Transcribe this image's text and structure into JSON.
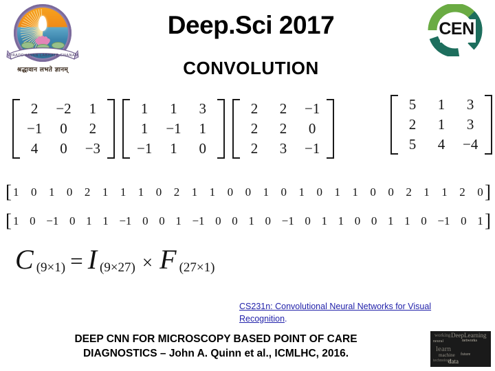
{
  "header": {
    "title": "Deep.Sci 2017",
    "subtitle": "CONVOLUTION",
    "university_logo": {
      "name": "university-emblem",
      "motto": "श्रद्धावान लभते ज्ञानम्",
      "banner_text": "SHRADDHAVAN LABHATE GNANAM",
      "colors": {
        "ring": "#8f7fae",
        "sky": "#f08a18",
        "water": "#3d86ae",
        "lotus": "#e285b8"
      }
    },
    "cen_logo": {
      "text": "CEN",
      "color_top": "#6aab43",
      "color_bottom": "#1d6e5d"
    }
  },
  "math": {
    "matrices": [
      {
        "name": "input-patch-matrix-1",
        "rows": [
          [
            "2",
            "−2",
            "1"
          ],
          [
            "−1",
            "0",
            "2"
          ],
          [
            "4",
            "0",
            "−3"
          ]
        ]
      },
      {
        "name": "input-patch-matrix-2",
        "rows": [
          [
            "1",
            "1",
            "3"
          ],
          [
            "1",
            "−1",
            "1"
          ],
          [
            "−1",
            "1",
            "0"
          ]
        ]
      },
      {
        "name": "input-patch-matrix-3",
        "rows": [
          [
            "2",
            "2",
            "−1"
          ],
          [
            "2",
            "2",
            "0"
          ],
          [
            "2",
            "3",
            "−1"
          ]
        ]
      },
      {
        "name": "result-matrix",
        "rows": [
          [
            "5",
            "1",
            "3"
          ],
          [
            "2",
            "1",
            "3"
          ],
          [
            "5",
            "4",
            "−4"
          ]
        ]
      }
    ],
    "vectors": [
      {
        "name": "image-row-vector",
        "values": [
          "1",
          "0",
          "1",
          "0",
          "2",
          "1",
          "1",
          "1",
          "0",
          "2",
          "1",
          "1",
          "0",
          "0",
          "1",
          "0",
          "1",
          "0",
          "1",
          "1",
          "0",
          "0",
          "2",
          "1",
          "1",
          "2",
          "0"
        ]
      },
      {
        "name": "filter-row-vector",
        "values": [
          "1",
          "0",
          "−1",
          "0",
          "1",
          "1",
          "−1",
          "0",
          "0",
          "1",
          "−1",
          "0",
          "0",
          "1",
          "0",
          "−1",
          "0",
          "1",
          "1",
          "0",
          "0",
          "1",
          "1",
          "0",
          "−1",
          "0",
          "1"
        ]
      }
    ],
    "equation": {
      "lhs_symbol": "C",
      "lhs_dim": "(9×1)",
      "equals": "=",
      "rhs1_symbol": "I",
      "rhs1_dim": "(9×27)",
      "times": "×",
      "rhs2_symbol": "F",
      "rhs2_dim": "(27×1)"
    }
  },
  "citation": {
    "link_text": "CS231n: Convolutional Neural Networks for Visual Recognition",
    "trailing": ".",
    "color": "#2222aa"
  },
  "footer": {
    "caption_line1": "DEEP CNN FOR MICROSCOPY BASED POINT OF CARE",
    "caption_line2": "DIAGNOSTICS – John A. Quinn et al., ICMLHC, 2016.",
    "thumbnail": {
      "name": "deep-learning-wordcloud-thumbnail",
      "words": [
        "working",
        "DeepLearning",
        "neural",
        "networks",
        "learn",
        "machine",
        "future",
        "data",
        "technology"
      ]
    }
  }
}
